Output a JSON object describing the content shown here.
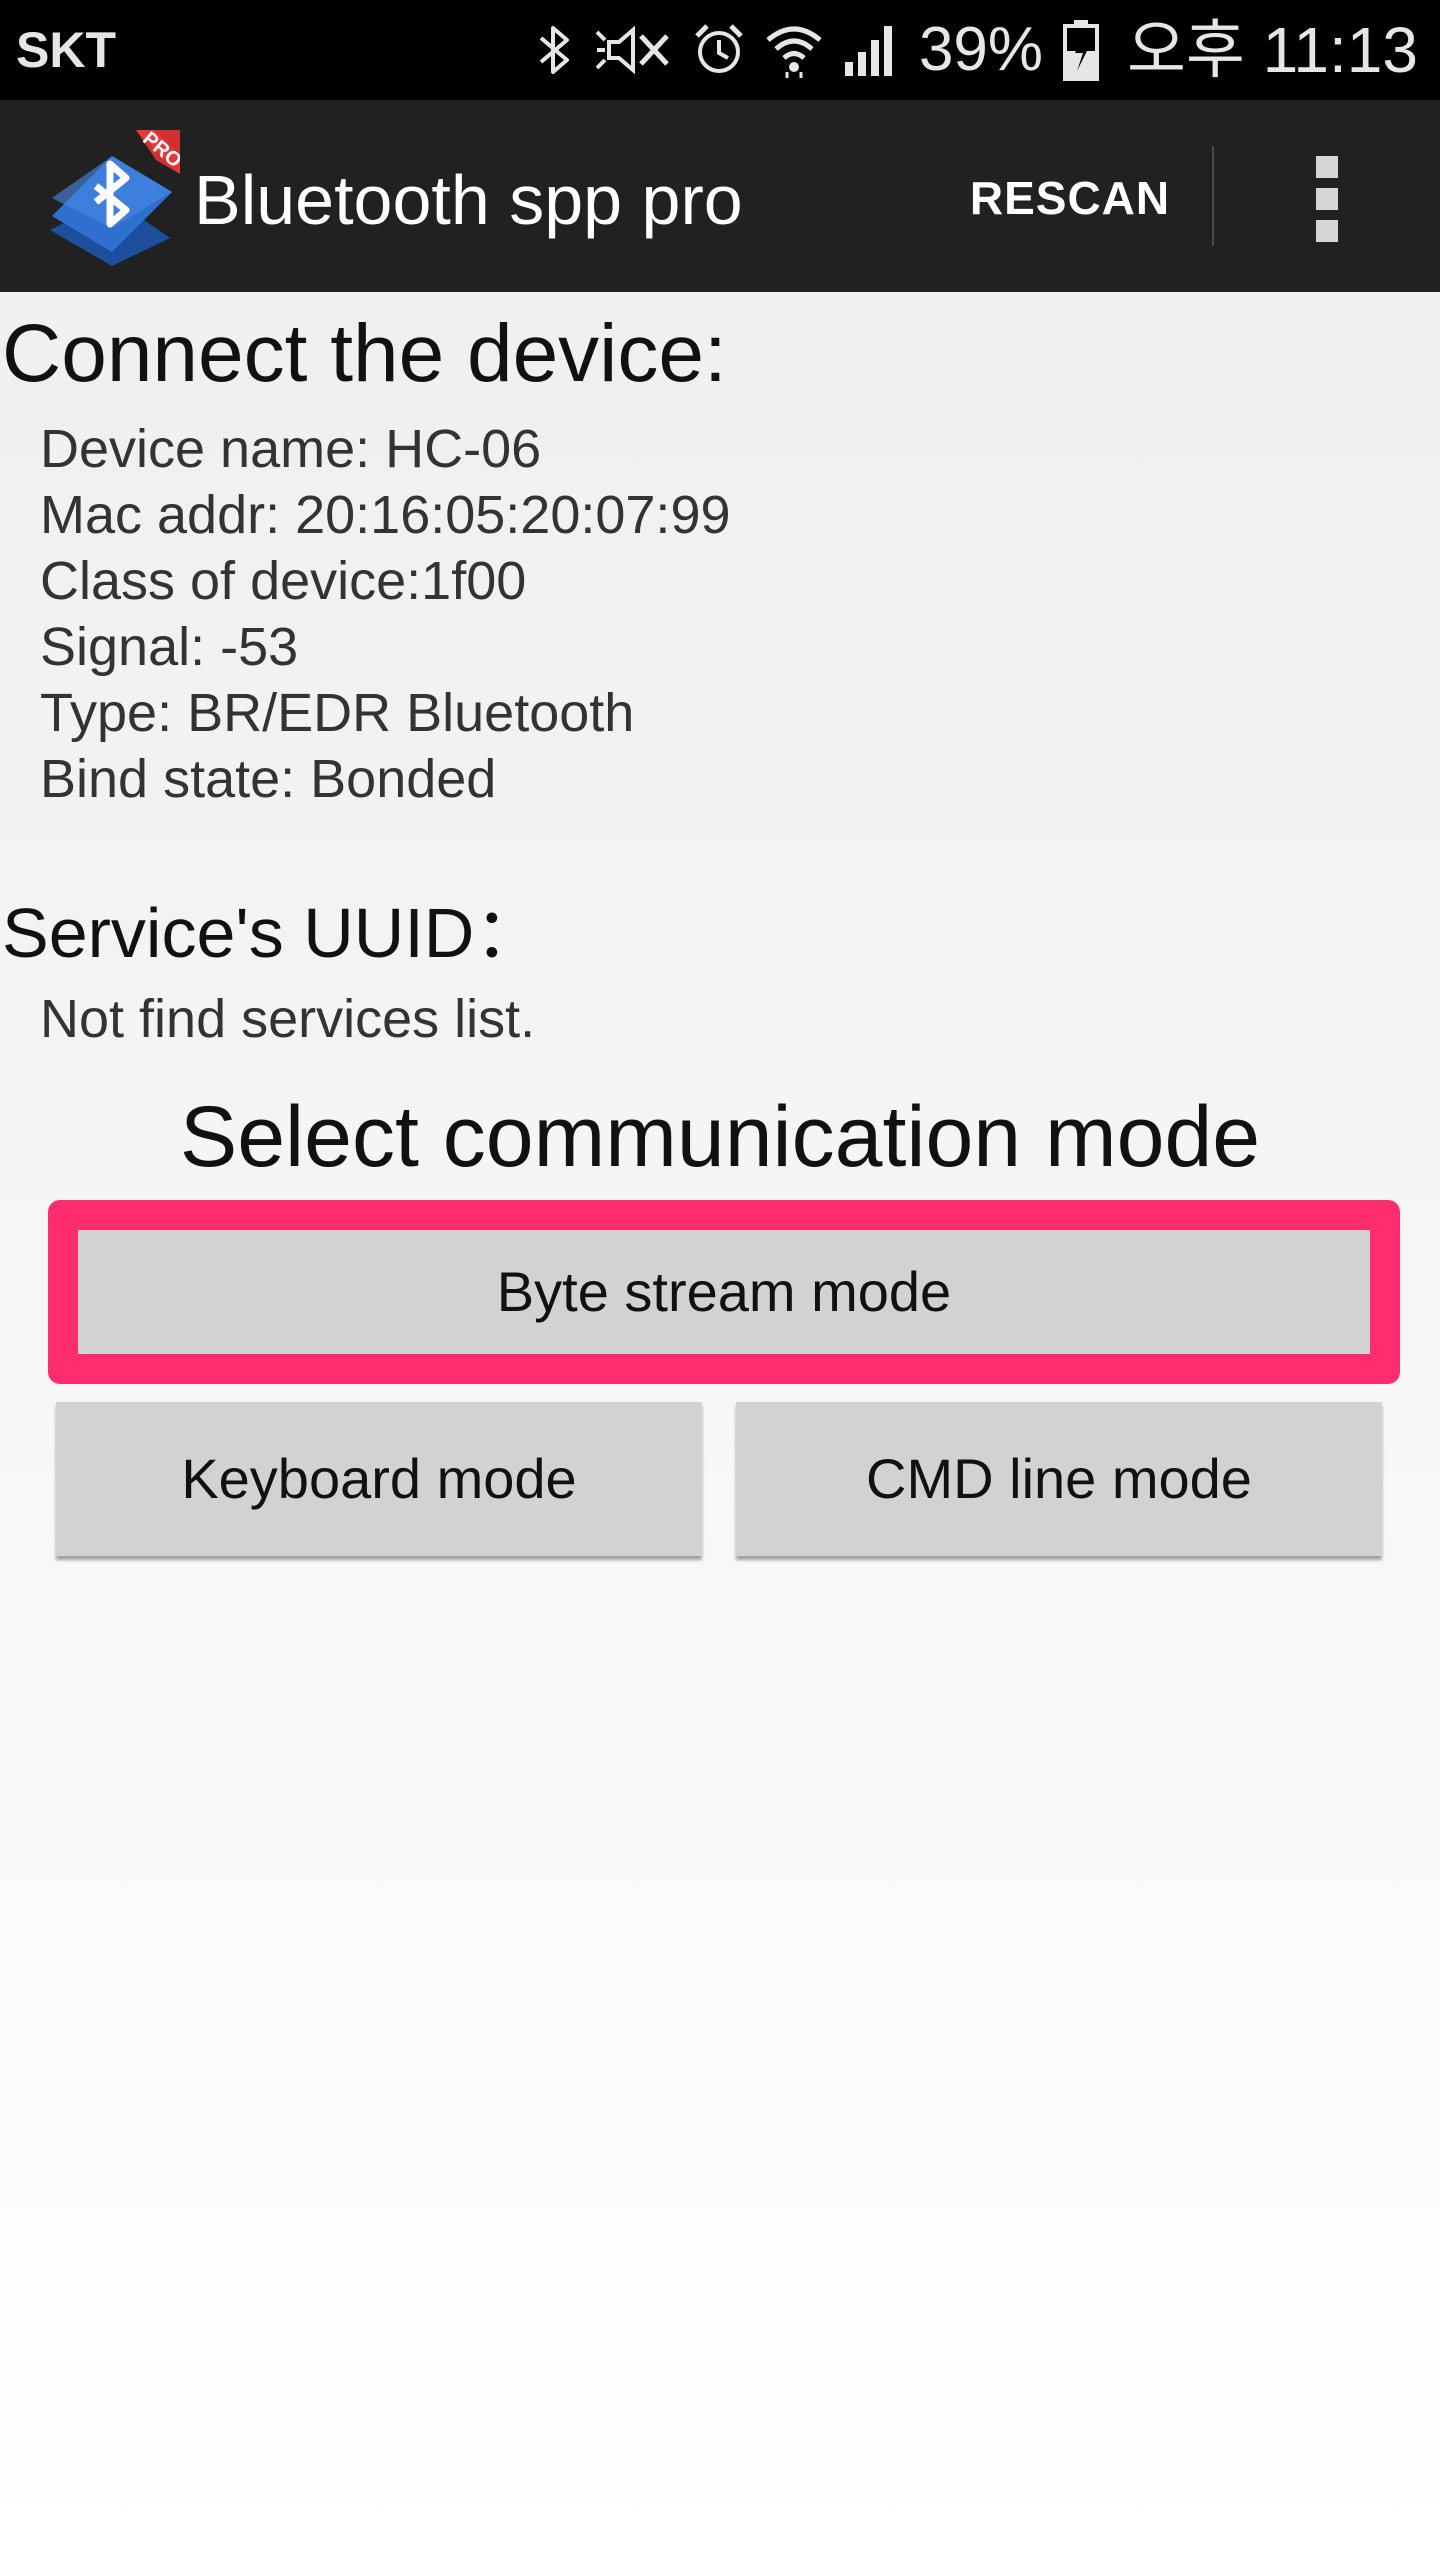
{
  "status_bar": {
    "carrier": "SKT",
    "icons": [
      "bluetooth-icon",
      "mute-icon",
      "alarm-icon",
      "wifi-icon",
      "signal-icon"
    ],
    "battery": "39%",
    "battery_icon": "battery-charging-icon",
    "time": "오후 11:13"
  },
  "action_bar": {
    "logo_badge": "PRO",
    "title": "Bluetooth spp pro",
    "rescan_label": "RESCAN",
    "overflow_icon": "more-vert-icon"
  },
  "device": {
    "heading": "Connect the device:",
    "info": [
      "Device name: HC-06",
      "Mac addr: 20:16:05:20:07:99",
      "Class of device:1f00",
      "Signal: -53",
      "Type: BR/EDR Bluetooth",
      "Bind state: Bonded"
    ]
  },
  "services": {
    "heading": "Service's UUID：",
    "text": "Not find services list."
  },
  "mode": {
    "heading": "Select communication mode",
    "byte_stream_label": "Byte stream mode",
    "keyboard_label": "Keyboard mode",
    "cmd_line_label": "CMD line mode"
  },
  "colors": {
    "action_bar": "#212121",
    "status_bar": "#000000",
    "button": "#d2d2d2",
    "highlight": "#ff2d6f",
    "logo_blue": "#2f6fcf",
    "logo_badge": "#d32f2f"
  }
}
